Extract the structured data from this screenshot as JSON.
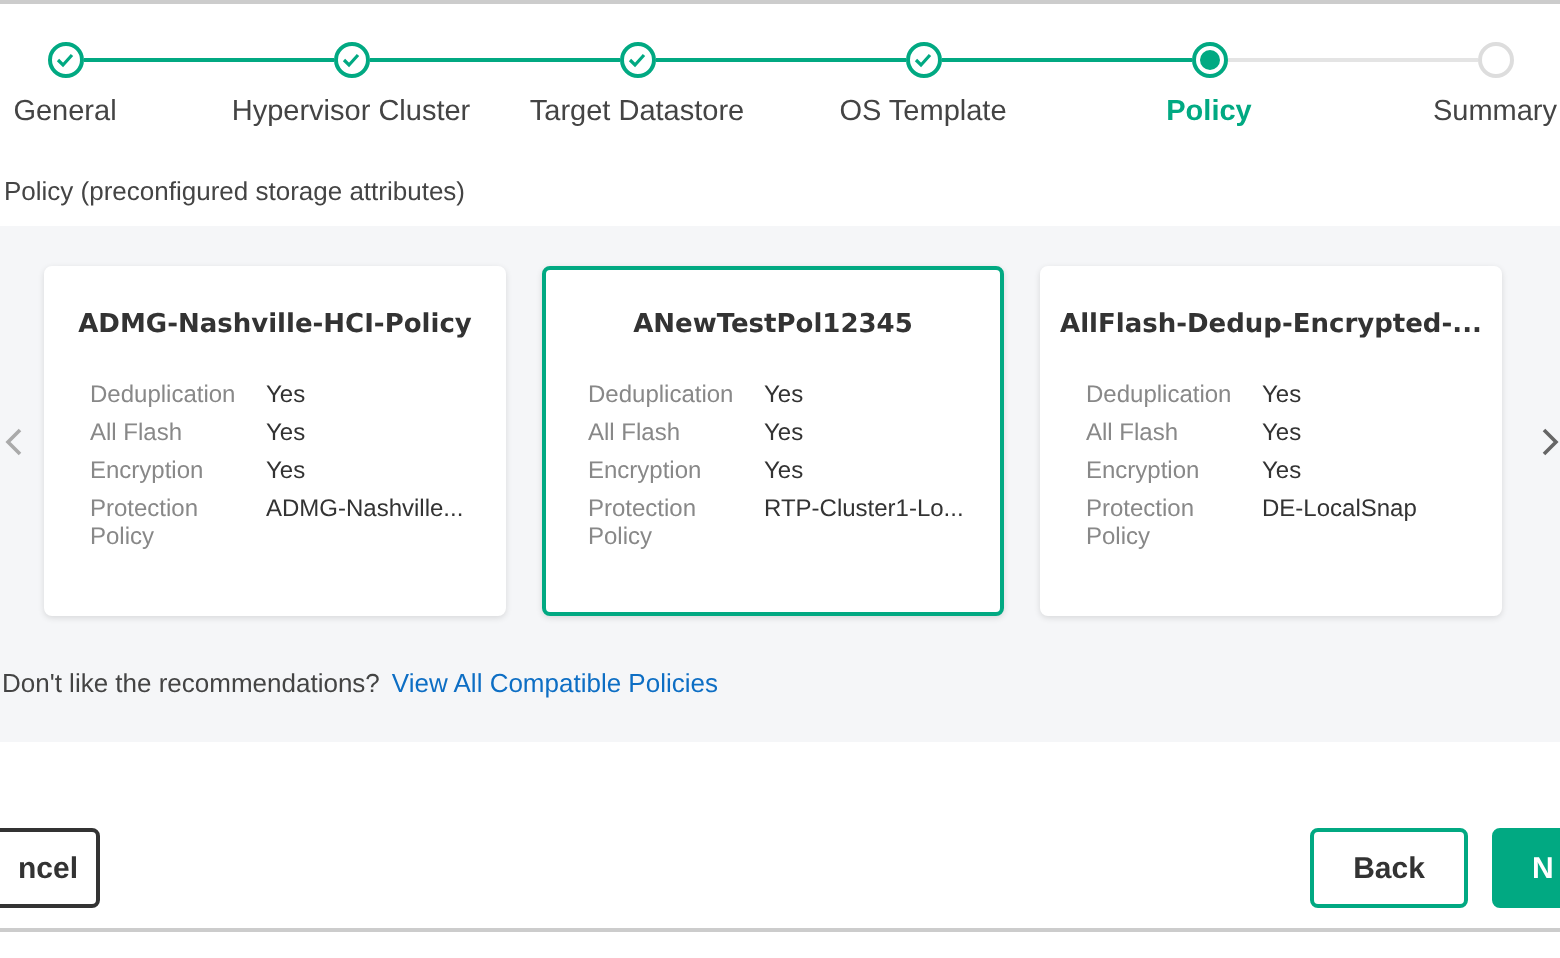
{
  "steps": [
    {
      "label": "General",
      "completed": true,
      "selected": false
    },
    {
      "label": "Hypervisor Cluster",
      "completed": true,
      "selected": false
    },
    {
      "label": "Target Datastore",
      "completed": true,
      "selected": false
    },
    {
      "label": "OS Template",
      "completed": true,
      "selected": false
    },
    {
      "label": "Policy",
      "completed": false,
      "selected": true
    },
    {
      "label": "Summary",
      "completed": false,
      "selected": false
    }
  ],
  "section_title": "Policy (preconfigured storage attributes)",
  "policies": [
    {
      "title": "ADMG-Nashville-HCI-Policy",
      "selected": false,
      "attributes": [
        {
          "label": "Deduplication",
          "value": "Yes"
        },
        {
          "label": "All Flash",
          "value": "Yes"
        },
        {
          "label": "Encryption",
          "value": "Yes"
        },
        {
          "label": "Protection Policy",
          "value": "ADMG-Nashville..."
        }
      ]
    },
    {
      "title": "ANewTestPol12345",
      "selected": true,
      "attributes": [
        {
          "label": "Deduplication",
          "value": "Yes"
        },
        {
          "label": "All Flash",
          "value": "Yes"
        },
        {
          "label": "Encryption",
          "value": "Yes"
        },
        {
          "label": "Protection Policy",
          "value": "RTP-Cluster1-Lo..."
        }
      ]
    },
    {
      "title": "AllFlash-Dedup-Encrypted-...",
      "selected": false,
      "attributes": [
        {
          "label": "Deduplication",
          "value": "Yes"
        },
        {
          "label": "All Flash",
          "value": "Yes"
        },
        {
          "label": "Encryption",
          "value": "Yes"
        },
        {
          "label": "Protection Policy",
          "value": "DE-LocalSnap"
        }
      ]
    }
  ],
  "recommendation": {
    "text": "Don't like the recommendations?",
    "link": "View All Compatible Policies"
  },
  "buttons": {
    "cancel": "ncel",
    "back": "Back",
    "next": "N"
  }
}
